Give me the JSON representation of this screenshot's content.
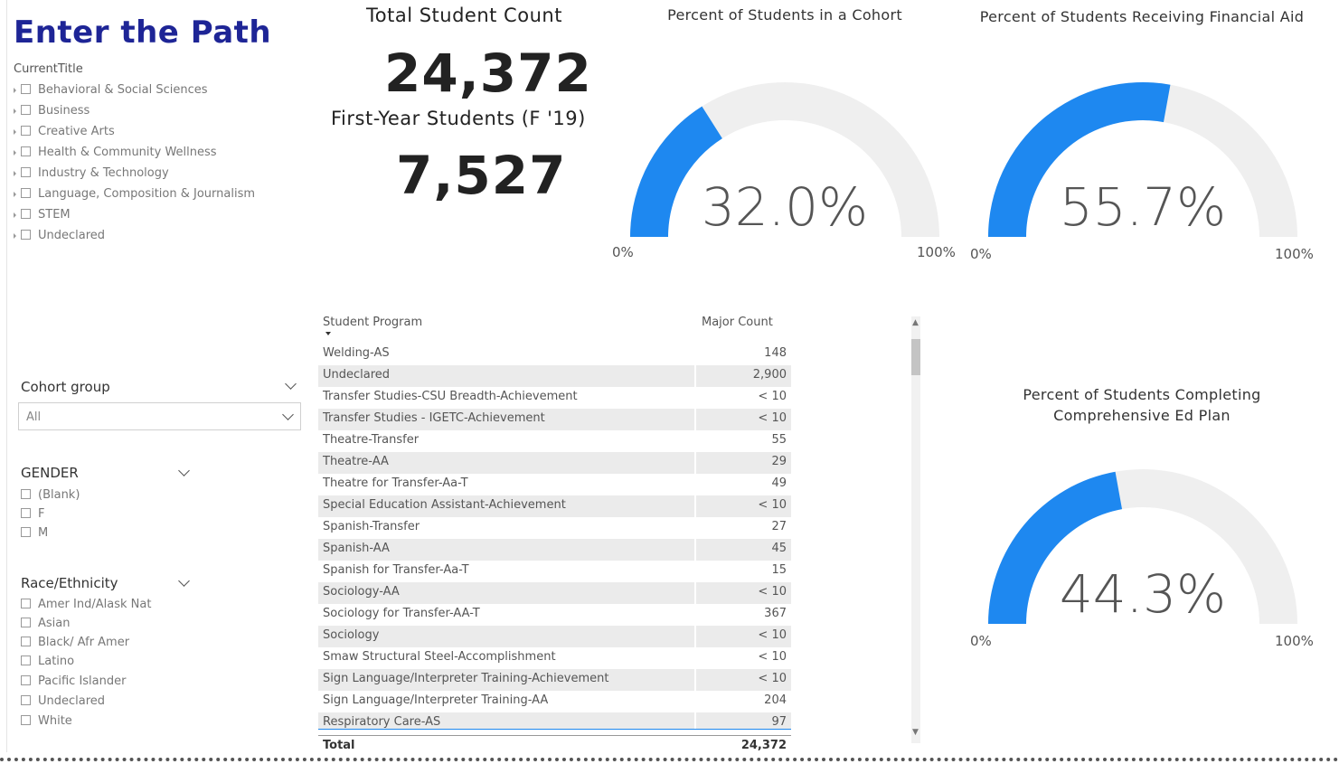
{
  "app_title": "Enter the Path",
  "current_title": {
    "label": "CurrentTitle",
    "items": [
      "Behavioral & Social Sciences",
      "Business",
      "Creative Arts",
      "Health & Community Wellness",
      "Industry & Technology",
      "Language, Composition & Journalism",
      "STEM",
      "Undeclared"
    ]
  },
  "kpi": {
    "total_title": "Total Student Count",
    "total_value": "24,372",
    "first_year_title": "First-Year Students (F '19)",
    "first_year_value": "7,527"
  },
  "gauges": {
    "cohort": {
      "title": "Percent of Students in a Cohort",
      "value_label": "32.0%",
      "value": 0.32,
      "min_label": "0%",
      "max_label": "100%"
    },
    "financial_aid": {
      "title": "Percent of Students Receiving Financial Aid",
      "value_label": "55.7%",
      "value": 0.557,
      "min_label": "0%",
      "max_label": "100%"
    },
    "ed_plan": {
      "title_line1": "Percent of Students Completing",
      "title_line2": "Comprehensive Ed Plan",
      "value_label": "44.3%",
      "value": 0.443,
      "min_label": "0%",
      "max_label": "100%"
    }
  },
  "colors": {
    "accent": "#1e88f0",
    "track": "#efefef",
    "title": "#1e2596"
  },
  "cohort_group": {
    "label": "Cohort group",
    "selected": "All"
  },
  "gender": {
    "label": "GENDER",
    "items": [
      "(Blank)",
      "F",
      "M"
    ]
  },
  "race": {
    "label": "Race/Ethnicity",
    "items": [
      "Amer Ind/Alask Nat",
      "Asian",
      "Black/ Afr Amer",
      "Latino",
      "Pacific Islander",
      "Undeclared",
      "White"
    ]
  },
  "table": {
    "col1": "Student Program",
    "col2": "Major Count",
    "rows": [
      [
        "Welding-AS",
        "148"
      ],
      [
        "Undeclared",
        "2,900"
      ],
      [
        "Transfer Studies-CSU Breadth-Achievement",
        "< 10"
      ],
      [
        "Transfer Studies - IGETC-Achievement",
        "< 10"
      ],
      [
        "Theatre-Transfer",
        "55"
      ],
      [
        "Theatre-AA",
        "29"
      ],
      [
        "Theatre for Transfer-Aa-T",
        "49"
      ],
      [
        "Special Education Assistant-Achievement",
        "< 10"
      ],
      [
        "Spanish-Transfer",
        "27"
      ],
      [
        "Spanish-AA",
        "45"
      ],
      [
        "Spanish for Transfer-Aa-T",
        "15"
      ],
      [
        "Sociology-AA",
        "< 10"
      ],
      [
        "Sociology for Transfer-AA-T",
        "367"
      ],
      [
        "Sociology",
        "< 10"
      ],
      [
        "Smaw Structural Steel-Accomplishment",
        "< 10"
      ],
      [
        "Sign Language/Interpreter Training-Achievement",
        "< 10"
      ],
      [
        "Sign Language/Interpreter Training-AA",
        "204"
      ],
      [
        "Respiratory Care-AS",
        "97"
      ]
    ],
    "total_label": "Total",
    "total_value": "24,372"
  }
}
